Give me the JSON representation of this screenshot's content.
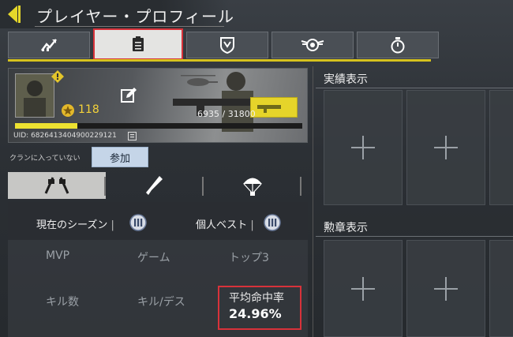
{
  "header": {
    "title": "プレイヤー・プロフィール"
  },
  "tabs": [
    {
      "icon": "chart-icon",
      "active": false
    },
    {
      "icon": "clipboard-icon",
      "active": true
    },
    {
      "icon": "shield-emblem-icon",
      "active": false
    },
    {
      "icon": "winged-badge-icon",
      "active": false
    },
    {
      "icon": "stopwatch-icon",
      "active": false
    }
  ],
  "profile": {
    "level": "118",
    "xp": "6935 / 31800",
    "xp_fraction": 0.218,
    "uid": "UID: 6826413404900229121"
  },
  "clan": {
    "status": "クランに入っていない",
    "join_label": "参加"
  },
  "mode_tabs": [
    {
      "icon": "multiplayer-icon",
      "active": true
    },
    {
      "icon": "battle-royale-icon",
      "active": false
    },
    {
      "icon": "parachute-icon",
      "active": false
    }
  ],
  "stats": {
    "current_season_label": "現在のシーズン",
    "personal_best_label": "個人ベスト",
    "row1": [
      "MVP",
      "ゲーム",
      "トップ3"
    ],
    "row2": [
      "キル数",
      "キル/デス",
      "平均命中率"
    ],
    "accuracy_value": "24.96%"
  },
  "right": {
    "achievements_title": "実績表示",
    "medals_title": "勲章表示"
  },
  "colors": {
    "accent_yellow": "#ede231",
    "highlight_red": "#d8323a",
    "join_button": "#c5d5e8"
  }
}
